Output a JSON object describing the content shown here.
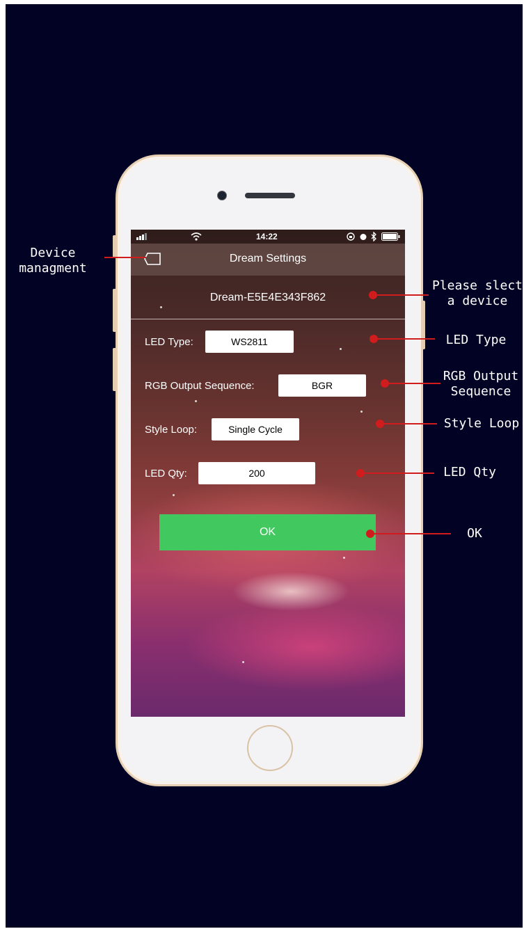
{
  "status_bar": {
    "time": "14:22"
  },
  "app": {
    "title": "Dream Settings",
    "device_name": "Dream-E5E4E343F862"
  },
  "settings": {
    "led_type_label": "LED Type:",
    "led_type_value": "WS2811",
    "rgb_label": "RGB Output Sequence:",
    "rgb_value": "BGR",
    "style_loop_label": "Style Loop:",
    "style_loop_value": "Single Cycle",
    "led_qty_label": "LED Qty:",
    "led_qty_value": "200",
    "ok_label": "OK"
  },
  "annotations": {
    "device_management": "Device\nmanagment",
    "select_device": "Please slect\na device",
    "led_type": "LED Type",
    "rgb_output": "RGB Output\nSequence",
    "style_loop": "Style Loop",
    "led_qty": "LED Qty",
    "ok": "OK"
  },
  "colors": {
    "page_background": "#020324",
    "annotation_line": "#d01c1c",
    "ok_button": "#41c95f",
    "phone_frame": "#e7cfb3"
  },
  "icons": [
    "back-icon",
    "signal-icon",
    "wifi-icon",
    "lock-rotation-icon",
    "alarm-icon",
    "bluetooth-icon",
    "battery-icon"
  ]
}
